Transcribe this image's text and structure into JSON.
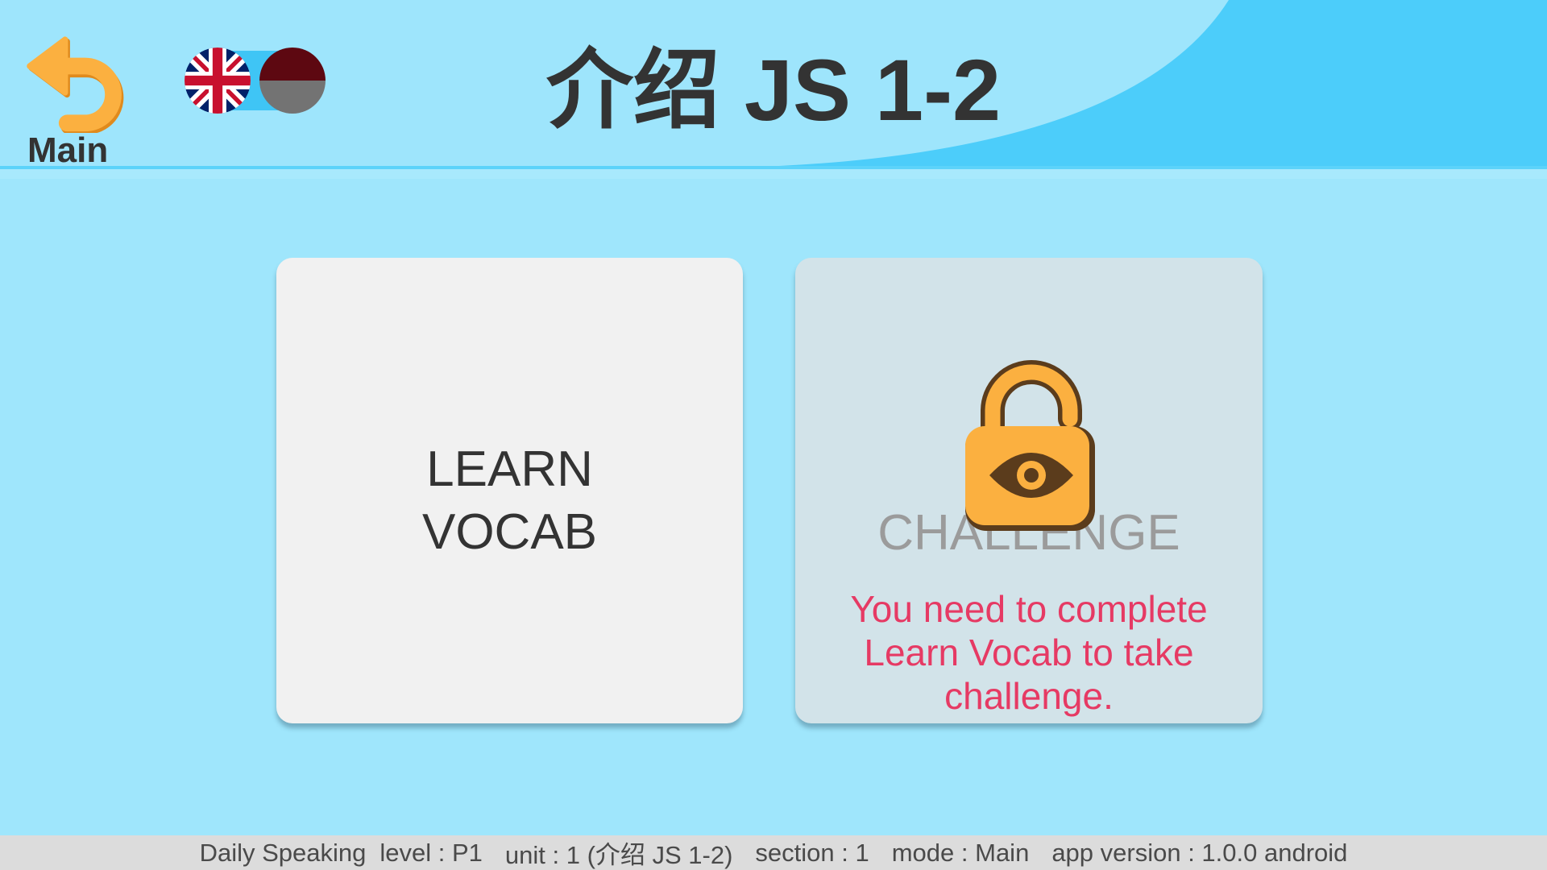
{
  "header": {
    "back_button": {
      "label": "Main",
      "icon": "back-arrow-icon"
    },
    "language_toggle": {
      "selected_index": 0,
      "flags": [
        {
          "icon": "uk-flag-icon"
        },
        {
          "icon": "indonesia-flag-icon"
        }
      ]
    },
    "title": "介绍 JS 1-2"
  },
  "cards": {
    "learn_vocab": {
      "lines": [
        "LEARN",
        "VOCAB"
      ]
    },
    "challenge": {
      "label": "CHALLENGE",
      "lock_icon": "lock-icon",
      "eye_icon": "eye-icon",
      "message_lines": [
        "You need to complete",
        "Learn Vocab to take",
        "challenge."
      ]
    }
  },
  "footer": {
    "items": [
      "Daily Speaking",
      "level : P1",
      "unit : 1 (介绍 JS 1-2)",
      "section : 1",
      "mode : Main",
      "app version : 1.0.0 android"
    ]
  },
  "colors": {
    "background": "#9fe6fc",
    "header_bg": "#9ee5fc",
    "header_swoosh": "#4ccdfa",
    "header_line": "#5cd3fa",
    "header_band": "#a8e9fd",
    "toggle_track": "#3fc5f5",
    "accent_orange": "#fbb040",
    "icon_dark": "#5b3c1c",
    "card_learn_bg": "#f1f1f1",
    "card_challenge_bg": "#d2e3e9",
    "challenge_label": "#9b9b9b",
    "warning_text": "#e63a64",
    "text_dark": "#333333",
    "footer_bg": "#dcdcdc",
    "footer_text": "#4a4a4a"
  }
}
